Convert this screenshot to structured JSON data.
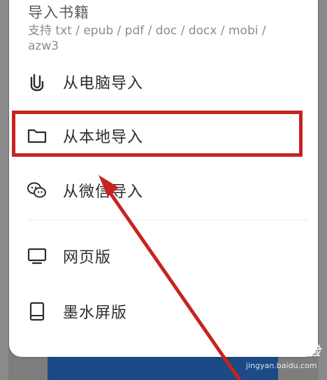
{
  "sheet": {
    "title": "导入书籍",
    "subtitle": "支持 txt / epub / pdf / doc / docx / mobi / azw3"
  },
  "menu": [
    {
      "label": "从电脑导入",
      "icon": "paperclip-icon"
    },
    {
      "label": "从本地导入",
      "icon": "folder-icon"
    },
    {
      "label": "从微信导入",
      "icon": "wechat-icon"
    },
    {
      "label": "网页版",
      "icon": "monitor-icon"
    },
    {
      "label": "墨水屏版",
      "icon": "tablet-icon"
    }
  ],
  "annotation": {
    "highlight_color": "#c8231f"
  },
  "watermark": {
    "brand": "Bai du 经验",
    "url": "jingyan.baidu.com"
  }
}
